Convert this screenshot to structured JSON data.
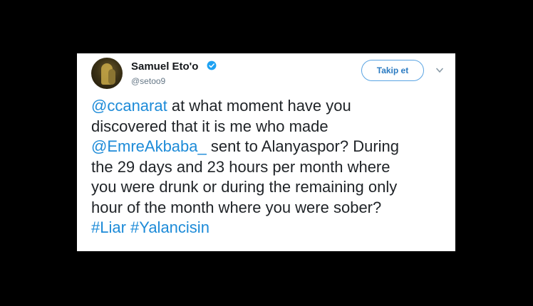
{
  "user": {
    "display_name": "Samuel Eto'o",
    "handle": "@setoo9",
    "verified_icon": "verified-badge-icon"
  },
  "follow_button": {
    "label": "Takip et"
  },
  "menu_icon": "chevron-down-icon",
  "tweet": {
    "line1": {
      "mention": "@ccanarat",
      "text": " at what moment have you"
    },
    "line2": {
      "text": "discovered that it is me who made"
    },
    "line3": {
      "mention": "@EmreAkbaba_",
      "text": " sent to Alanyaspor? During"
    },
    "line4": {
      "text": "the 29 days and 23 hours per month where"
    },
    "line5": {
      "text": "you were drunk or during the remaining only"
    },
    "line6": {
      "text": "hour of the month where you were sober?"
    },
    "line7": {
      "hashtag1": "#Liar",
      "sep": " ",
      "hashtag2": "#Yalancisin"
    }
  },
  "colors": {
    "background": "#000000",
    "card": "#ffffff",
    "link": "#1d8bd8",
    "verified": "#1da1f2",
    "text": "#1f2327",
    "secondary": "#657786"
  }
}
